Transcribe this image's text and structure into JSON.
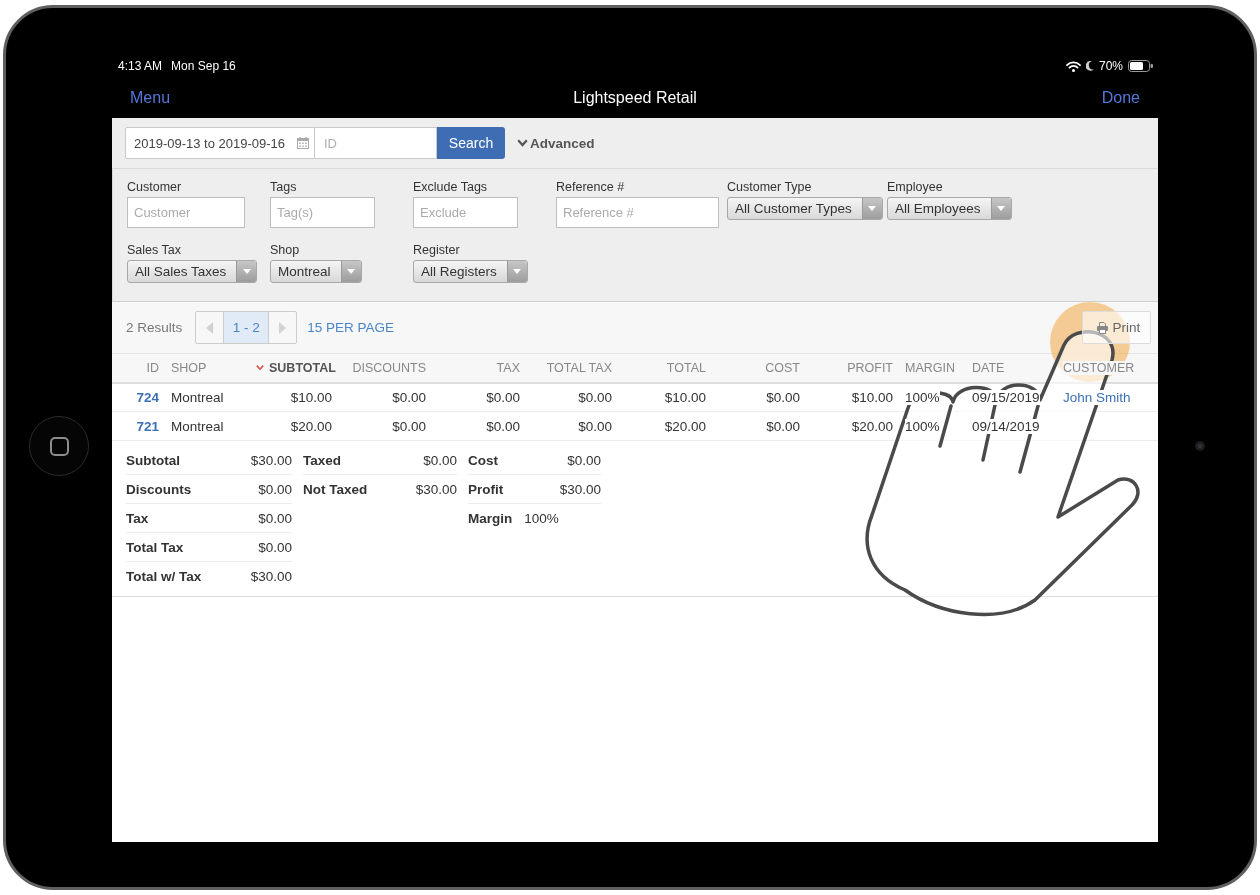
{
  "status_bar": {
    "time": "4:13 AM",
    "date": "Mon Sep 16",
    "battery": "70%"
  },
  "nav_bar": {
    "menu": "Menu",
    "title": "Lightspeed Retail",
    "done": "Done"
  },
  "search_bar": {
    "date_range": "2019-09-13 to 2019-09-16",
    "id_placeholder": "ID",
    "search_button": "Search",
    "advanced": "Advanced"
  },
  "filters": [
    [
      {
        "label": "Customer",
        "kind": "text",
        "placeholder": "Customer"
      },
      {
        "label": "Tags",
        "kind": "text",
        "placeholder": "Tag(s)"
      },
      {
        "label": "Exclude Tags",
        "kind": "text",
        "placeholder": "Exclude"
      },
      {
        "label": "Reference #",
        "kind": "text",
        "placeholder": "Reference #"
      },
      {
        "label": "Customer Type",
        "kind": "select",
        "value": "All Customer Types"
      },
      {
        "label": "Employee",
        "kind": "select",
        "value": "All Employees"
      }
    ],
    [
      {
        "label": "Sales Tax",
        "kind": "select",
        "value": "All Sales Taxes"
      },
      {
        "label": "Shop",
        "kind": "select",
        "value": "Montreal"
      },
      {
        "label": "Register",
        "kind": "select",
        "value": "All Registers"
      }
    ]
  ],
  "results_bar": {
    "count": "2 Results",
    "pagination": {
      "previous_disabled": true,
      "pages": [
        {
          "label": "1 - 2",
          "selected": true
        }
      ],
      "next_disabled": true
    },
    "per_page": "15 PER PAGE",
    "print_button": "Print"
  },
  "table": {
    "columns": [
      {
        "label": "ID",
        "kind": "id",
        "sorted": false
      },
      {
        "label": "SHOP",
        "kind": "text",
        "sorted": false
      },
      {
        "label": "SUBTOTAL",
        "kind": "money",
        "sorted": true
      },
      {
        "label": "DISCOUNTS",
        "kind": "money",
        "sorted": false
      },
      {
        "label": "TAX",
        "kind": "money",
        "sorted": false
      },
      {
        "label": "TOTAL TAX",
        "kind": "money",
        "sorted": false
      },
      {
        "label": "TOTAL",
        "kind": "money",
        "sorted": false
      },
      {
        "label": "COST",
        "kind": "money",
        "sorted": false
      },
      {
        "label": "PROFIT",
        "kind": "money",
        "sorted": false
      },
      {
        "label": "MARGIN",
        "kind": "text",
        "sorted": false
      },
      {
        "label": "DATE",
        "kind": "text",
        "sorted": false
      },
      {
        "label": "CUSTOMER",
        "kind": "link",
        "sorted": false
      }
    ],
    "rows": [
      {
        "cells": [
          "724",
          "Montreal",
          "$10.00",
          "$0.00",
          "$0.00",
          "$0.00",
          "$10.00",
          "$0.00",
          "$10.00",
          "100%",
          "09/15/2019",
          "John Smith"
        ]
      },
      {
        "cells": [
          "721",
          "Montreal",
          "$20.00",
          "$0.00",
          "$0.00",
          "$0.00",
          "$20.00",
          "$0.00",
          "$20.00",
          "100%",
          "09/14/2019"
        ]
      }
    ]
  },
  "summary": [
    [
      {
        "label": "Subtotal",
        "value": "$30.00",
        "kind": "amount"
      },
      {
        "label": "Discounts",
        "value": "$0.00",
        "kind": "amount"
      },
      {
        "label": "Tax",
        "value": "$0.00",
        "kind": "amount"
      },
      {
        "label": "Total Tax",
        "value": "$0.00",
        "kind": "amount"
      },
      {
        "label": "Total w/ Tax",
        "value": "$30.00",
        "kind": "amount"
      }
    ],
    [
      {
        "label": "Taxed",
        "value": "$0.00",
        "kind": "amount"
      },
      {
        "label": "Not Taxed",
        "value": "$30.00",
        "kind": "amount"
      }
    ],
    [
      {
        "label": "Cost",
        "value": "$0.00",
        "kind": "amount"
      },
      {
        "label": "Profit",
        "value": "$30.00",
        "kind": "amount"
      },
      {
        "label": "Margin",
        "value": "100%",
        "kind": "inline"
      }
    ]
  ]
}
